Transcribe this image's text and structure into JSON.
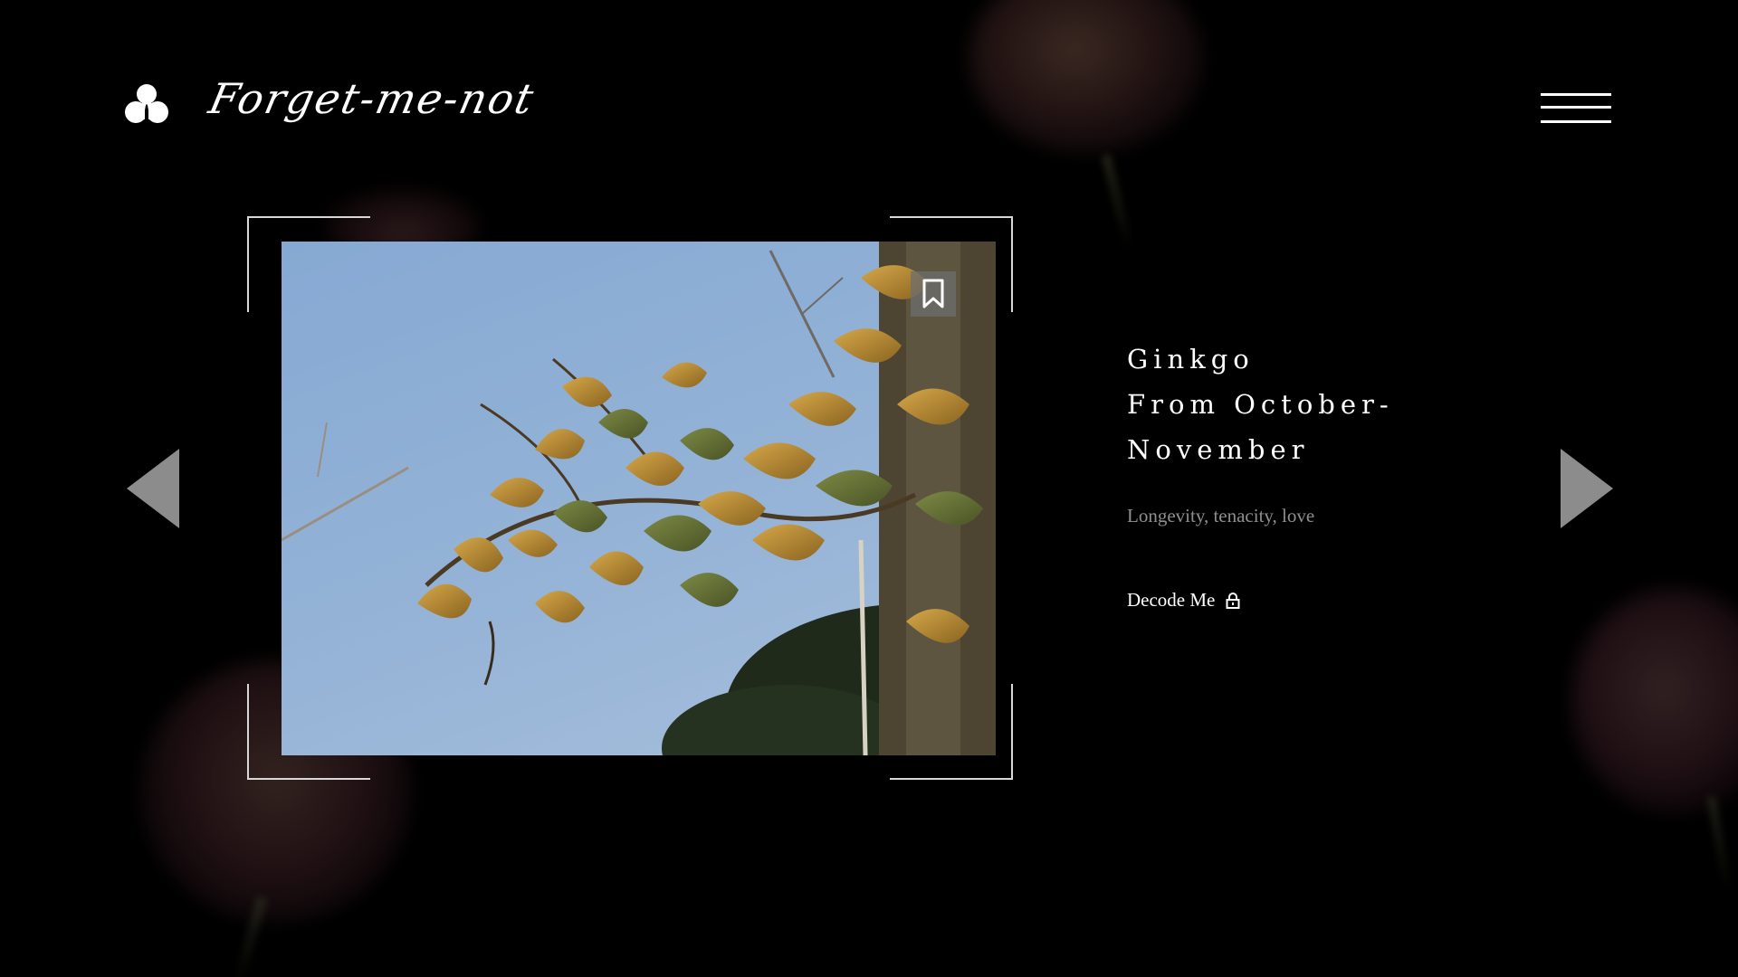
{
  "header": {
    "brand": "Forget-me-not",
    "logo_icon": "clover-logo-icon",
    "menu_icon": "hamburger-menu-icon"
  },
  "gallery": {
    "image_subject": "ginkgo leaves",
    "bookmark_icon": "bookmark-icon",
    "prev_icon": "triangle-left-icon",
    "next_icon": "triangle-right-icon"
  },
  "info": {
    "title_lines": [
      "Ginkgo",
      "From October-",
      "November"
    ],
    "subtitle": "Longevity, tenacity, love",
    "decode_label": "Decode Me",
    "decode_icon": "lock-icon"
  },
  "colors": {
    "background": "#000000",
    "text": "#ffffff",
    "muted_text": "#8f8f8f",
    "arrow": "#8c8c8c"
  }
}
